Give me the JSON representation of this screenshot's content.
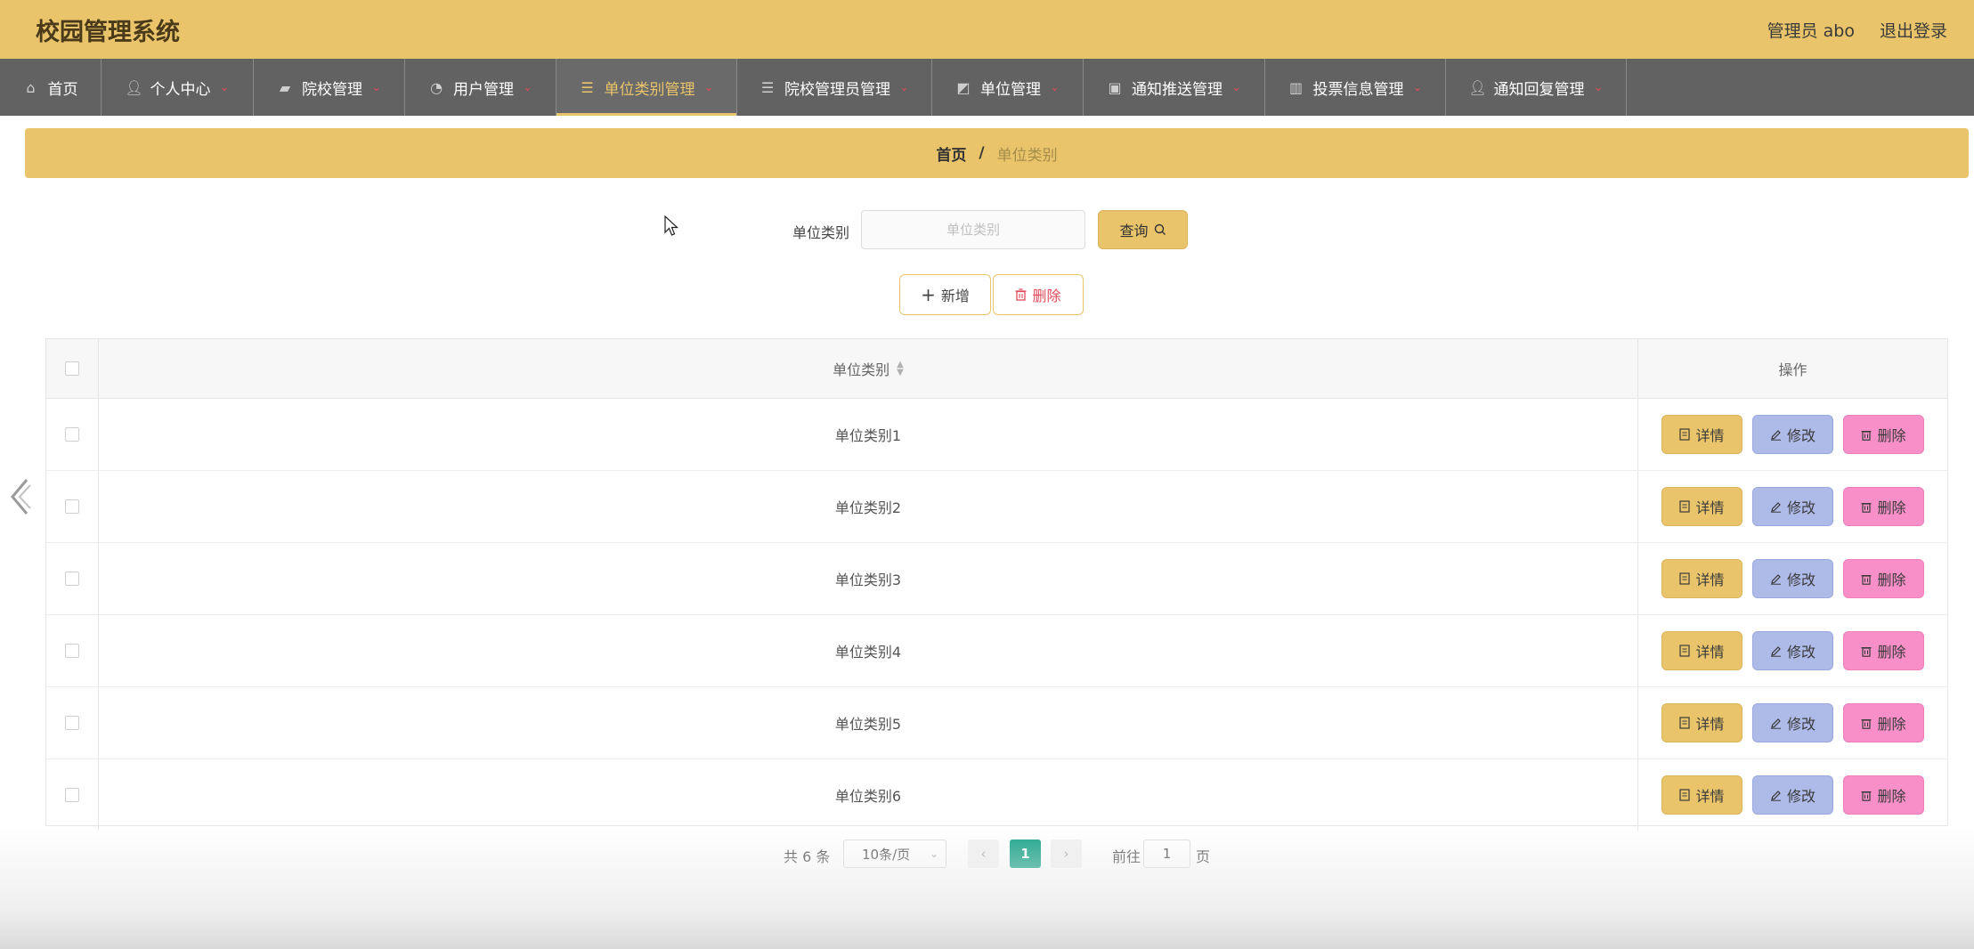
{
  "app": {
    "title": "校园管理系统"
  },
  "header": {
    "user_label": "管理员 abo",
    "logout": "退出登录"
  },
  "nav": {
    "items": [
      {
        "label": "首页",
        "icon": "home-icon"
      },
      {
        "label": "个人中心",
        "icon": "user-icon"
      },
      {
        "label": "院校管理",
        "icon": "ticket-icon"
      },
      {
        "label": "用户管理",
        "icon": "gauge-icon"
      },
      {
        "label": "单位类别管理",
        "icon": "menu-icon",
        "active": true
      },
      {
        "label": "院校管理员管理",
        "icon": "menu-icon"
      },
      {
        "label": "单位管理",
        "icon": "chart-icon"
      },
      {
        "label": "通知推送管理",
        "icon": "briefcase-icon"
      },
      {
        "label": "投票信息管理",
        "icon": "books-icon"
      },
      {
        "label": "通知回复管理",
        "icon": "user-icon"
      }
    ]
  },
  "breadcrumb": {
    "home": "首页",
    "separator": "/",
    "current": "单位类别"
  },
  "search": {
    "label": "单位类别",
    "placeholder": "单位类别",
    "value": "",
    "button": "查询"
  },
  "actions": {
    "add": "新增",
    "delete": "删除"
  },
  "table": {
    "headers": {
      "type": "单位类别",
      "ops": "操作"
    },
    "rows": [
      {
        "type": "单位类别1"
      },
      {
        "type": "单位类别2"
      },
      {
        "type": "单位类别3"
      },
      {
        "type": "单位类别4"
      },
      {
        "type": "单位类别5"
      },
      {
        "type": "单位类别6"
      }
    ],
    "row_actions": {
      "detail": "详情",
      "edit": "修改",
      "delete": "删除"
    }
  },
  "pagination": {
    "total": "共 6 条",
    "page_size": "10条/页",
    "current_page": "1",
    "goto_label": "前往",
    "goto_value": "1",
    "page_suffix": "页"
  },
  "colors": {
    "accent": "#e9c46a",
    "nav_bg": "#626262",
    "detail_btn": "#e9c46a",
    "edit_btn": "#aebbe8",
    "delete_btn": "#f98fc8",
    "page_active": "#1aa38a"
  }
}
